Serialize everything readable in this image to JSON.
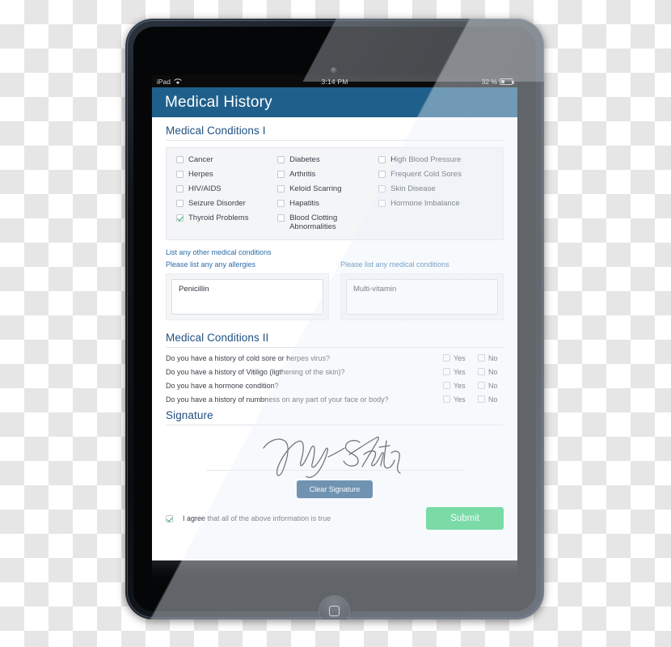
{
  "status_bar": {
    "carrier": "iPad",
    "wifi_icon": "wifi-icon",
    "time": "3:14 PM",
    "battery_percent": "32 %",
    "battery_icon": "battery-icon"
  },
  "app": {
    "title": "Medical History",
    "header_color": "#1f5f8b"
  },
  "section_one": {
    "title": "Medical Conditions I",
    "columns": [
      [
        {
          "label": "Cancer",
          "checked": false
        },
        {
          "label": "Herpes",
          "checked": false
        },
        {
          "label": "HIV/AIDS",
          "checked": false
        },
        {
          "label": "Seizure Disorder",
          "checked": false
        },
        {
          "label": "Thyroid Problems",
          "checked": true
        }
      ],
      [
        {
          "label": "Diabetes",
          "checked": false
        },
        {
          "label": "Arthritis",
          "checked": false
        },
        {
          "label": "Keloid Scarring",
          "checked": false
        },
        {
          "label": "Hapatitis",
          "checked": false
        },
        {
          "label": "Blood Clotting Abnormalities",
          "checked": false
        }
      ],
      [
        {
          "label": "High Blood Pressure",
          "checked": false
        },
        {
          "label": "Frequent Cold Sores",
          "checked": false
        },
        {
          "label": "Skin Disease",
          "checked": false
        },
        {
          "label": "Hormone Imbalance",
          "checked": false
        }
      ]
    ]
  },
  "other_conditions": {
    "intro_link": "List any other medical conditions",
    "allergies": {
      "label": "Please list any any allergies",
      "value": "Penicillin"
    },
    "conditions": {
      "label": "Please list any medical conditions",
      "value": "Multi-vitamin"
    }
  },
  "section_two": {
    "title": "Medical Conditions II",
    "yes_label": "Yes",
    "no_label": "No",
    "questions": [
      {
        "text": "Do you have a history of cold sore or herpes virus?",
        "yes": false,
        "no": false
      },
      {
        "text": "Do you have a history of Vitiligo (ligthening of the skin)?",
        "yes": false,
        "no": false
      },
      {
        "text": "Do you have a hormone condition?",
        "yes": false,
        "no": false
      },
      {
        "text": "Do you have a history of numbness on any part of your face or body?",
        "yes": false,
        "no": false
      }
    ]
  },
  "signature": {
    "title": "Signature",
    "signed_name": "Mary Smith",
    "clear_label": "Clear Signature",
    "clear_color": "#1f5483"
  },
  "footer": {
    "agree_label": "I agree that all of the above information is true",
    "agree_checked": true,
    "submit_label": "Submit",
    "submit_color": "#2ecc71"
  }
}
